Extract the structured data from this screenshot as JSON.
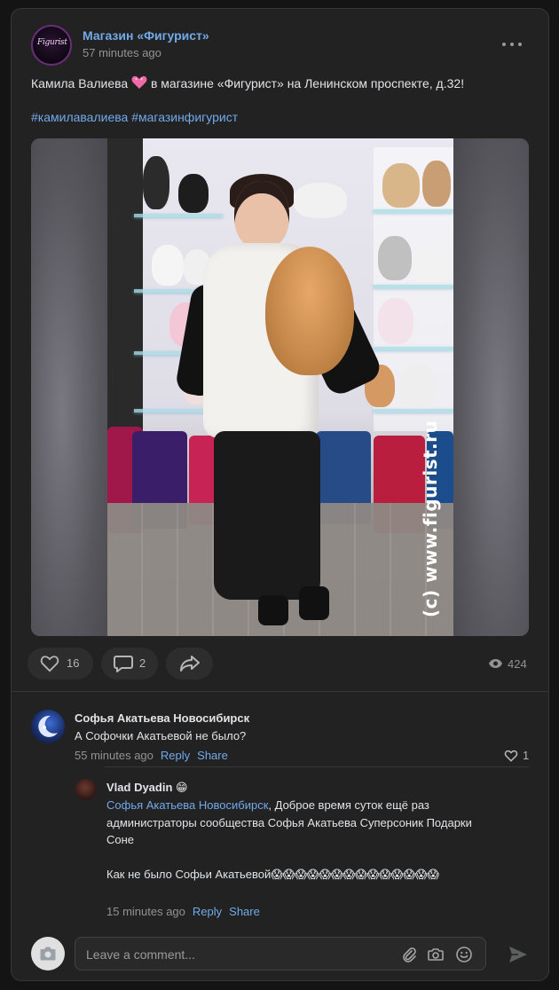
{
  "post": {
    "author": "Магазин «Фигурист»",
    "avatar_logo": "Figurist",
    "time": "57 minutes ago",
    "text_before": "Камила Валиева ",
    "text_after": " в магазине «Фигурист» на Ленинском проспекте, д.32!",
    "hashtags": "#камилавалиева #магазинфигурист",
    "watermark": "(c) www.figurist.ru",
    "likes": "16",
    "comments": "2",
    "views": "424"
  },
  "comments": [
    {
      "author": "Софья Акатьева Новосибирск",
      "text": "А Софочки Акатьевой не было?",
      "time": "55 minutes ago",
      "reply_label": "Reply",
      "share_label": "Share",
      "likes": "1"
    }
  ],
  "reply": {
    "author": "Vlad Dyadin",
    "author_emoji": "😁",
    "mention": "Софья Акатьева Новосибирск",
    "text_line1": ", Доброе время суток ещё раз администраторы сообщества Софья Акатьева Суперсоник Подарки Соне",
    "text_line2": "Как не было Софьи Акатьевой😱😱😱😱😱😱😱😱😱😱😱😱😱😱",
    "time": "15 minutes ago",
    "reply_label": "Reply",
    "share_label": "Share"
  },
  "composer": {
    "placeholder": "Leave a comment..."
  },
  "colors": {
    "accent": "#71aaeb",
    "background": "#141414",
    "card": "#222222"
  },
  "icons": [
    "more-icon",
    "heart-icon",
    "comment-icon",
    "share-icon",
    "eye-icon",
    "camera-icon",
    "paperclip-icon",
    "smile-icon",
    "send-icon"
  ]
}
